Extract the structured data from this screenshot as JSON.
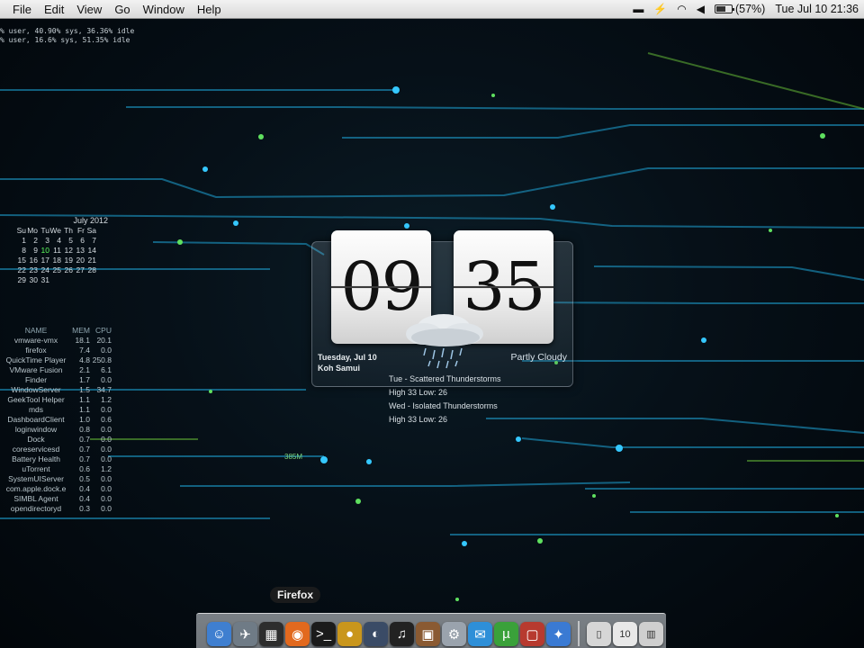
{
  "menubar": {
    "menus": [
      "File",
      "Edit",
      "View",
      "Go",
      "Window",
      "Help"
    ],
    "battery_percent": "(57%)",
    "battery_level": 0.57,
    "clock": "Tue Jul 10  21:36"
  },
  "cpu_monitor": {
    "line1": "% user, 40.90% sys, 36.36% idle",
    "line2": "% user, 16.6% sys, 51.35% idle"
  },
  "calendar": {
    "title": "July 2012",
    "weekdays": [
      "Su",
      "Mo",
      "Tu",
      "We",
      "Th",
      "Fr",
      "Sa"
    ],
    "rows": [
      [
        "1",
        "2",
        "3",
        "4",
        "5",
        "6",
        "7"
      ],
      [
        "8",
        "9",
        "10",
        "11",
        "12",
        "13",
        "14"
      ],
      [
        "15",
        "16",
        "17",
        "18",
        "19",
        "20",
        "21"
      ],
      [
        "22",
        "23",
        "24",
        "25",
        "26",
        "27",
        "28"
      ],
      [
        "29",
        "30",
        "31",
        "",
        "",
        "",
        ""
      ]
    ],
    "today": "10"
  },
  "process_table": {
    "headers": [
      "NAME",
      "MEM",
      "CPU"
    ],
    "rows": [
      [
        "vmware-vmx",
        "18.1",
        "20.1"
      ],
      [
        "firefox",
        "7.4",
        "0.0"
      ],
      [
        "QuickTime Player",
        "4.8",
        "250.8"
      ],
      [
        "VMware Fusion",
        "2.1",
        "6.1"
      ],
      [
        "Finder",
        "1.7",
        "0.0"
      ],
      [
        "WindowServer",
        "1.5",
        "34.7"
      ],
      [
        "GeekTool Helper",
        "1.1",
        "1.2"
      ],
      [
        "mds",
        "1.1",
        "0.0"
      ],
      [
        "DashboardClient",
        "1.0",
        "0.6"
      ],
      [
        "loginwindow",
        "0.8",
        "0.0"
      ],
      [
        "Dock",
        "0.7",
        "0.0"
      ],
      [
        "coreservicesd",
        "0.7",
        "0.0"
      ],
      [
        "Battery Health",
        "0.7",
        "0.0"
      ],
      [
        "uTorrent",
        "0.6",
        "1.2"
      ],
      [
        "SystemUIServer",
        "0.5",
        "0.0"
      ],
      [
        "com.apple.dock.e",
        "0.4",
        "0.0"
      ],
      [
        "SIMBL Agent",
        "0.4",
        "0.0"
      ],
      [
        "opendirectoryd",
        "0.3",
        "0.0"
      ]
    ]
  },
  "memory_tag": "385M",
  "clock_widget": {
    "hours": "09",
    "minutes": "35",
    "date": "Tuesday, Jul 10",
    "location": "Koh Samui",
    "condition": "Partly Cloudy"
  },
  "forecast": [
    "Tue - Scattered Thunderstorms",
    "High 33 Low: 26",
    "Wed - Isolated Thunderstorms",
    "High 33 Low: 26"
  ],
  "dock": {
    "hover_label": "Firefox",
    "apps": [
      {
        "name": "finder-icon",
        "glyph": "☺",
        "color": "#3f7fd0"
      },
      {
        "name": "launchpad-icon",
        "glyph": "✈",
        "color": "#6f7b86"
      },
      {
        "name": "mission-control-icon",
        "glyph": "▦",
        "color": "#2d2d2d"
      },
      {
        "name": "firefox-icon",
        "glyph": "◉",
        "color": "#e2691e"
      },
      {
        "name": "terminal-icon",
        "glyph": ">_",
        "color": "#1b1b1b"
      },
      {
        "name": "system-icon",
        "glyph": "●",
        "color": "#c9961c"
      },
      {
        "name": "quicktime-icon",
        "glyph": "◐",
        "color": "#3a4b66"
      },
      {
        "name": "itunes-icon",
        "glyph": "♫",
        "color": "#222222"
      },
      {
        "name": "photos-icon",
        "glyph": "▣",
        "color": "#8a5a32"
      },
      {
        "name": "preview-icon",
        "glyph": "⚙",
        "color": "#9aa3ad"
      },
      {
        "name": "messages-icon",
        "glyph": "✉",
        "color": "#2e8fd8"
      },
      {
        "name": "utorrent-icon",
        "glyph": "µ",
        "color": "#3aa13a"
      },
      {
        "name": "vmware-icon",
        "glyph": "▢",
        "color": "#b73a2f"
      },
      {
        "name": "safari-icon",
        "glyph": "✦",
        "color": "#3a7ad3"
      }
    ],
    "docs": [
      {
        "name": "document-icon",
        "glyph": "▯",
        "color": "#d6d6d6"
      },
      {
        "name": "calendar-doc-icon",
        "glyph": "10",
        "color": "#e8e8e8"
      },
      {
        "name": "applications-folder-icon",
        "glyph": "▥",
        "color": "#cfcfcf"
      }
    ]
  }
}
